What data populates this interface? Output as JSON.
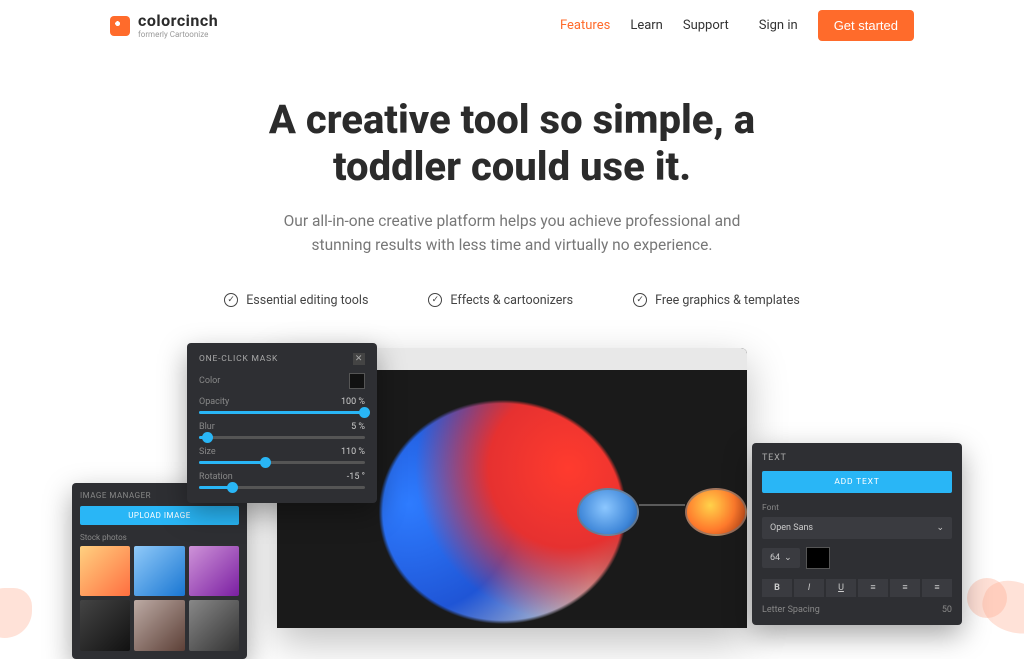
{
  "header": {
    "brand": "colorcinch",
    "tagline": "formerly Cartoonize",
    "nav": {
      "features": "Features",
      "learn": "Learn",
      "support": "Support",
      "signin": "Sign in",
      "cta": "Get started"
    }
  },
  "hero": {
    "title_l1": "A creative tool so simple, a",
    "title_l2": "toddler could use it.",
    "sub_l1": "Our all-in-one creative platform helps you achieve professional and",
    "sub_l2": "stunning results with less time and virtually no experience."
  },
  "features": {
    "a": "Essential editing tools",
    "b": "Effects & cartoonizers",
    "c": "Free graphics & templates"
  },
  "mask_panel": {
    "title": "ONE-CLICK MASK",
    "color_label": "Color",
    "opacity_label": "Opacity",
    "opacity_val": "100 %",
    "blur_label": "Blur",
    "blur_val": "5 %",
    "size_label": "Size",
    "size_val": "110 %",
    "rotation_label": "Rotation",
    "rotation_val": "-15 °"
  },
  "image_panel": {
    "title": "IMAGE MANAGER",
    "upload": "UPLOAD IMAGE",
    "subtitle": "Stock photos"
  },
  "text_panel": {
    "title": "TEXT",
    "add": "ADD TEXT",
    "font_label": "Font",
    "font_value": "Open Sans",
    "size_value": "64",
    "spacing_label": "Letter Spacing",
    "spacing_value": "50"
  }
}
